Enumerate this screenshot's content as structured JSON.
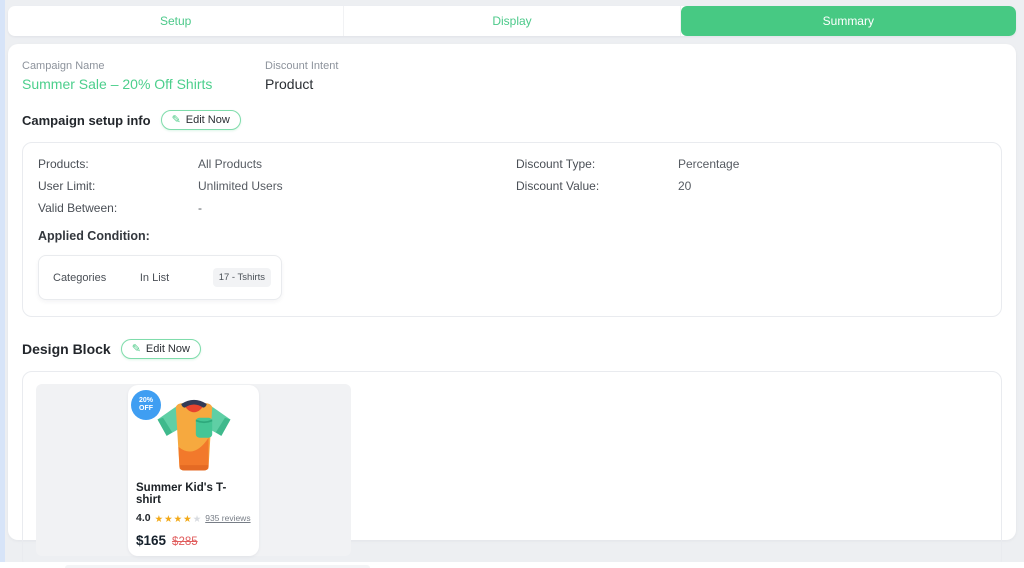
{
  "tabs": [
    {
      "label": "Setup"
    },
    {
      "label": "Display"
    },
    {
      "label": "Summary"
    }
  ],
  "accent_color": "#47c983",
  "header": {
    "campaign_name_label": "Campaign Name",
    "campaign_name_value": "Summer Sale – 20% Off Shirts",
    "discount_intent_label": "Discount Intent",
    "discount_intent_value": "Product"
  },
  "setup_section": {
    "title": "Campaign setup info",
    "edit_button_label": "Edit Now",
    "edit_icon": "✎",
    "rows": [
      {
        "label": "Products:",
        "value": "All Products",
        "label2": "Discount Type:",
        "value2": "Percentage"
      },
      {
        "label": "User Limit:",
        "value": "Unlimited Users",
        "label2": "Discount Value:",
        "value2": "20"
      },
      {
        "label": "Valid Between:",
        "value": "-",
        "label2": "",
        "value2": ""
      }
    ],
    "applied_condition_label": "Applied Condition:",
    "condition": {
      "field": "Categories",
      "operator": "In List",
      "value_chip": "17 - Tshirts"
    }
  },
  "design_section": {
    "title": "Design Block",
    "edit_button_label": "Edit Now",
    "edit_icon": "✎",
    "product": {
      "badge_line1": "20%",
      "badge_line2": "OFF",
      "badge_color": "#3f9ef2",
      "title": "Summer Kid's T-shirt",
      "rating": "4.0",
      "stars_filled": "★★★★",
      "stars_empty": "★",
      "reviews_link": "935 reviews",
      "price": "$165",
      "old_price": "$285",
      "star_color": "#f2a918",
      "old_price_color": "#e05c5c"
    }
  }
}
